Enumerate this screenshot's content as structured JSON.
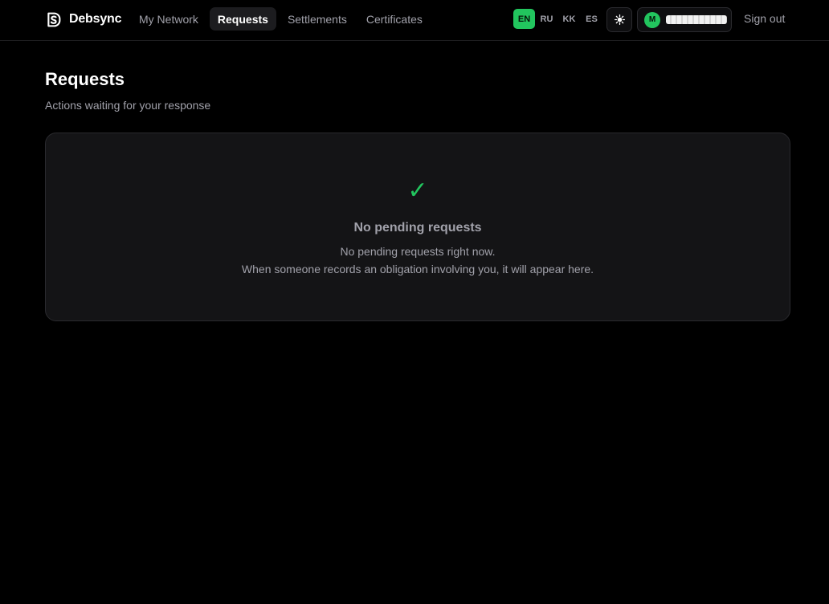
{
  "brand": {
    "name": "Debsync",
    "logo_icon": "debsync-logo-icon"
  },
  "nav": {
    "items": [
      {
        "label": "My Network",
        "active": false
      },
      {
        "label": "Requests",
        "active": true
      },
      {
        "label": "Settlements",
        "active": false
      },
      {
        "label": "Certificates",
        "active": false
      }
    ]
  },
  "languages": {
    "items": [
      "EN",
      "RU",
      "KK",
      "ES"
    ],
    "selected": "EN"
  },
  "theme_toggle": {
    "icon": "sun-icon"
  },
  "user": {
    "avatar_initial": "M"
  },
  "header": {
    "signout_label": "Sign out"
  },
  "page": {
    "title": "Requests",
    "subtitle": "Actions waiting for your response"
  },
  "empty_state": {
    "icon": "✓",
    "title": "No pending requests",
    "line1": "No pending requests right now.",
    "line2": "When someone records an obligation involving you, it will appear here."
  },
  "colors": {
    "background": "#000000",
    "accent": "#22c55e",
    "card": "#141416",
    "border": "#2a2a2e",
    "muted_text": "#a1a1aa"
  }
}
